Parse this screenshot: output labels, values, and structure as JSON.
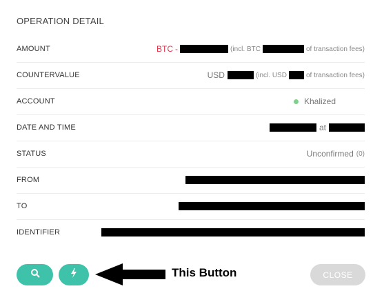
{
  "title": "OPERATION DETAIL",
  "rows": {
    "amount": {
      "label": "AMOUNT",
      "currency": "BTC",
      "dash": "-",
      "incl": "(incl. BTC",
      "suffix": "of transaction fees)"
    },
    "countervalue": {
      "label": "COUNTERVALUE",
      "currency": "USD",
      "incl": "(incl. USD",
      "suffix": "of transaction fees)"
    },
    "account": {
      "label": "ACCOUNT",
      "value": "Khalized"
    },
    "date": {
      "label": "DATE AND TIME",
      "at": "at"
    },
    "status": {
      "label": "STATUS",
      "value": "Unconfirmed",
      "count": "(0)"
    },
    "from": {
      "label": "FROM"
    },
    "to": {
      "label": "TO"
    },
    "identifier": {
      "label": "IDENTIFIER"
    }
  },
  "buttons": {
    "search_icon": "search-icon",
    "bolt_icon": "lightning-icon",
    "close": "CLOSE"
  },
  "annotation": "This Button",
  "colors": {
    "accent": "#3ec3aa",
    "btc": "#e0344b",
    "close_bg": "#d9d9d9",
    "account_dot": "#7fd08a"
  }
}
